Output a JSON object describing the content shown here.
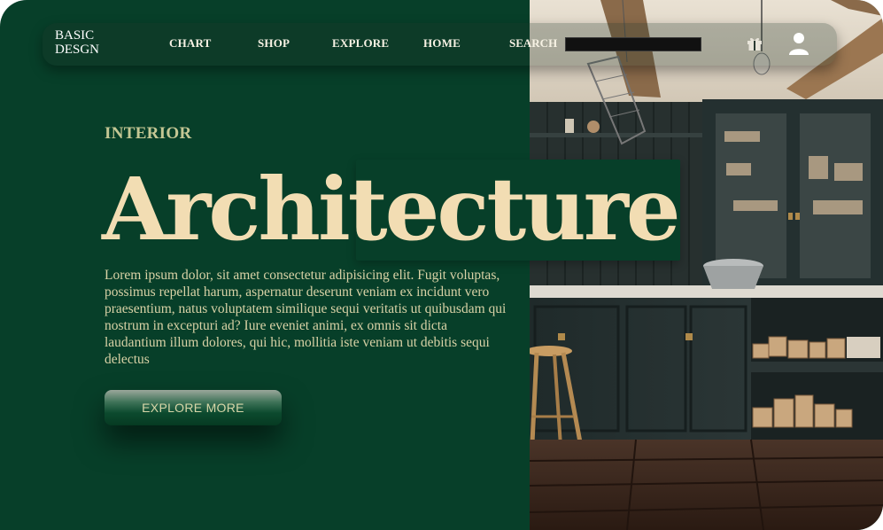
{
  "brand": {
    "line1": "BASIC",
    "line2": "DESGN"
  },
  "nav": {
    "links": [
      "CHART",
      "SHOP",
      "EXPLORE",
      "HOME"
    ],
    "search_label": "SEARCH",
    "search_value": "",
    "icons": [
      "gift-icon",
      "user-icon"
    ]
  },
  "hero": {
    "eyebrow": "INTERIOR",
    "title": "Architecture",
    "description": "Lorem ipsum dolor, sit amet consectetur adipisicing elit. Fugit voluptas, possimus repellat harum, aspernatur deserunt veniam ex incidunt vero praesentium, natus voluptatem similique sequi veritatis ut quibusdam qui nostrum in excepturi ad? Iure eveniet animi, ex omnis sit dicta laudantium illum dolores, qui hic, mollitia iste veniam ut debitis sequi delectus",
    "cta_label": "EXPLORE MORE"
  },
  "colors": {
    "background_green": "#073f29",
    "title_cream": "#f2ddb3",
    "eyebrow_olive": "#c4c794",
    "body_text": "#d9d2a6",
    "nav_text": "#f7f2e4"
  }
}
